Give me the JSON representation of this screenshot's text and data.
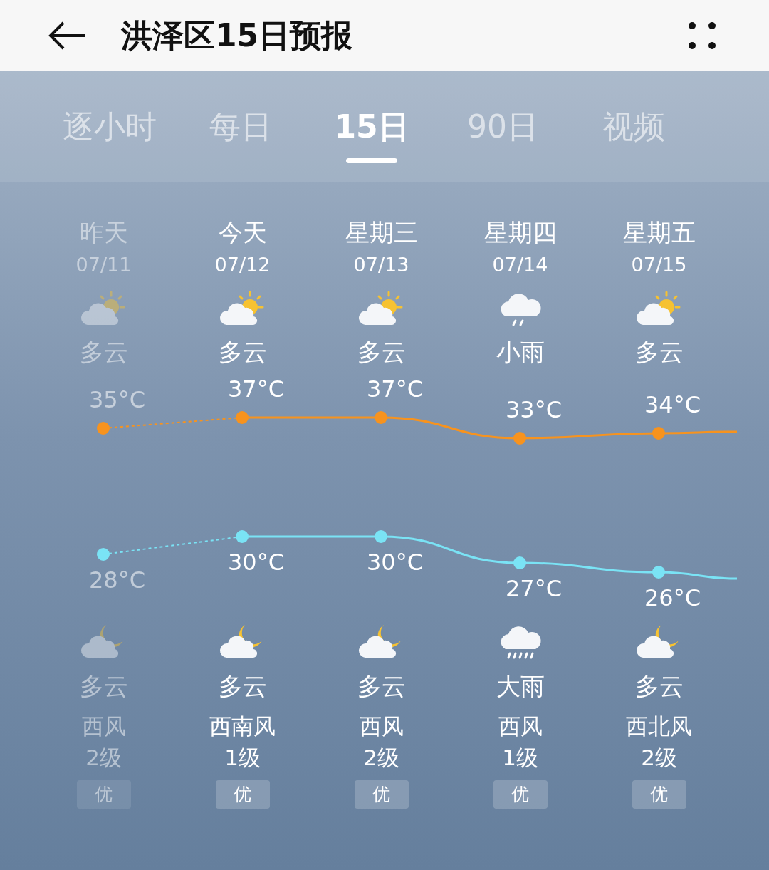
{
  "header": {
    "title": "洪泽区15日预报"
  },
  "tabs": [
    {
      "label": "逐小时",
      "selected": false
    },
    {
      "label": "每日",
      "selected": false
    },
    {
      "label": "15日",
      "selected": true
    },
    {
      "label": "90日",
      "selected": false
    },
    {
      "label": "视频",
      "selected": false
    }
  ],
  "days": [
    {
      "name": "昨天",
      "date": "07/11",
      "past": true,
      "day_icon": {
        "kind": "sun_cloud"
      },
      "day_condition": "多云",
      "high": "35°C",
      "low": "28°C",
      "night_icon": {
        "kind": "moon_cloud"
      },
      "night_condition": "多云",
      "wind": "西风",
      "wind_level": "2级",
      "aqi": "优"
    },
    {
      "name": "今天",
      "date": "07/12",
      "past": false,
      "day_icon": {
        "kind": "sun_cloud"
      },
      "day_condition": "多云",
      "high": "37°C",
      "low": "30°C",
      "night_icon": {
        "kind": "moon_cloud"
      },
      "night_condition": "多云",
      "wind": "西南风",
      "wind_level": "1级",
      "aqi": "优"
    },
    {
      "name": "星期三",
      "date": "07/13",
      "past": false,
      "day_icon": {
        "kind": "sun_cloud"
      },
      "day_condition": "多云",
      "high": "37°C",
      "low": "30°C",
      "night_icon": {
        "kind": "moon_cloud"
      },
      "night_condition": "多云",
      "wind": "西风",
      "wind_level": "2级",
      "aqi": "优"
    },
    {
      "name": "星期四",
      "date": "07/14",
      "past": false,
      "day_icon": {
        "kind": "rain_light"
      },
      "day_condition": "小雨",
      "high": "33°C",
      "low": "27°C",
      "night_icon": {
        "kind": "rain_heavy"
      },
      "night_condition": "大雨",
      "wind": "西风",
      "wind_level": "1级",
      "aqi": "优"
    },
    {
      "name": "星期五",
      "date": "07/15",
      "past": false,
      "day_icon": {
        "kind": "sun_cloud"
      },
      "day_condition": "多云",
      "high": "34°C",
      "low": "26°C",
      "night_icon": {
        "kind": "moon_cloud"
      },
      "night_condition": "多云",
      "wind": "西北风",
      "wind_level": "2级",
      "aqi": "优"
    }
  ]
}
